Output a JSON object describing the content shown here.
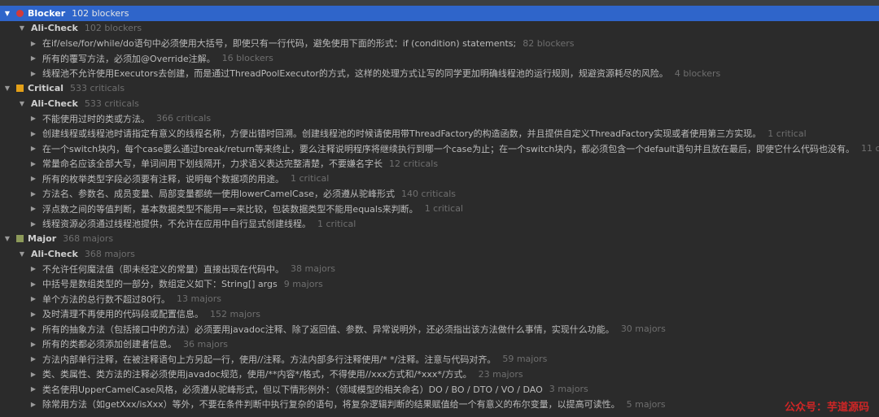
{
  "tree": {
    "groups": [
      {
        "name": "Blocker",
        "count": "102 blockers",
        "selected": true,
        "icon": "blocker-icon",
        "sub": {
          "name": "Ali-Check",
          "count": "102 blockers"
        },
        "items": [
          {
            "text": "在if/else/for/while/do语句中必须使用大括号，即使只有一行代码，避免使用下面的形式：if (condition) statements;",
            "count": "82 blockers"
          },
          {
            "text": "所有的覆写方法，必须加@Override注解。",
            "count": "16 blockers"
          },
          {
            "text": "线程池不允许使用Executors去创建，而是通过ThreadPoolExecutor的方式，这样的处理方式让写的同学更加明确线程池的运行规则，规避资源耗尽的风险。",
            "count": "4 blockers"
          }
        ]
      },
      {
        "name": "Critical",
        "count": "533 criticals",
        "selected": false,
        "icon": "critical-icon",
        "sub": {
          "name": "Ali-Check",
          "count": "533 criticals"
        },
        "items": [
          {
            "text": "不能使用过时的类或方法。",
            "count": "366 criticals"
          },
          {
            "text": "创建线程或线程池时请指定有意义的线程名称，方便出错时回溯。创建线程池的时候请使用带ThreadFactory的构造函数，并且提供自定义ThreadFactory实现或者使用第三方实现。",
            "count": "1 critical"
          },
          {
            "text": "在一个switch块内，每个case要么通过break/return等来终止，要么注释说明程序将继续执行到哪一个case为止；在一个switch块内，都必须包含一个default语句并且放在最后，即使它什么代码也没有。",
            "count": "11 criticals"
          },
          {
            "text": "常量命名应该全部大写，单词间用下划线隔开，力求语义表达完整清楚，不要嫌名字长",
            "count": "12 criticals"
          },
          {
            "text": "所有的枚举类型字段必须要有注释，说明每个数据项的用途。",
            "count": "1 critical"
          },
          {
            "text": "方法名、参数名、成员变量、局部变量都统一使用lowerCamelCase，必须遵从驼峰形式",
            "count": "140 criticals"
          },
          {
            "text": "浮点数之间的等值判断，基本数据类型不能用==来比较，包装数据类型不能用equals来判断。",
            "count": "1 critical"
          },
          {
            "text": "线程资源必须通过线程池提供，不允许在应用中自行显式创建线程。",
            "count": "1 critical"
          }
        ]
      },
      {
        "name": "Major",
        "count": "368 majors",
        "selected": false,
        "icon": "major-icon",
        "sub": {
          "name": "Ali-Check",
          "count": "368 majors"
        },
        "items": [
          {
            "text": "不允许任何魔法值（即未经定义的常量）直接出现在代码中。",
            "count": "38 majors"
          },
          {
            "text": "中括号是数组类型的一部分，数组定义如下：String[] args",
            "count": "9 majors"
          },
          {
            "text": "单个方法的总行数不超过80行。",
            "count": "13 majors"
          },
          {
            "text": "及时清理不再使用的代码段或配置信息。",
            "count": "152 majors"
          },
          {
            "text": "所有的抽象方法（包括接口中的方法）必须要用javadoc注释、除了返回值、参数、异常说明外，还必须指出该方法做什么事情，实现什么功能。",
            "count": "30 majors"
          },
          {
            "text": "所有的类都必须添加创建者信息。",
            "count": "36 majors"
          },
          {
            "text": "方法内部单行注释，在被注释语句上方另起一行，使用//注释。方法内部多行注释使用/* */注释。注意与代码对齐。",
            "count": "59 majors"
          },
          {
            "text": "类、类属性、类方法的注释必须使用javadoc规范，使用/**内容*/格式，不得使用//xxx方式和/*xxx*/方式。",
            "count": "23 majors"
          },
          {
            "text": "类名使用UpperCamelCase风格，必须遵从驼峰形式，但以下情形例外：（领域模型的相关命名）DO / BO / DTO / VO / DAO",
            "count": "3 majors"
          },
          {
            "text": "除常用方法（如getXxx/isXxx）等外，不要在条件判断中执行复杂的语句，将复杂逻辑判断的结果赋值给一个有意义的布尔变量，以提高可读性。",
            "count": "5 majors"
          }
        ]
      }
    ]
  },
  "watermark": "公众号：芋道源码"
}
